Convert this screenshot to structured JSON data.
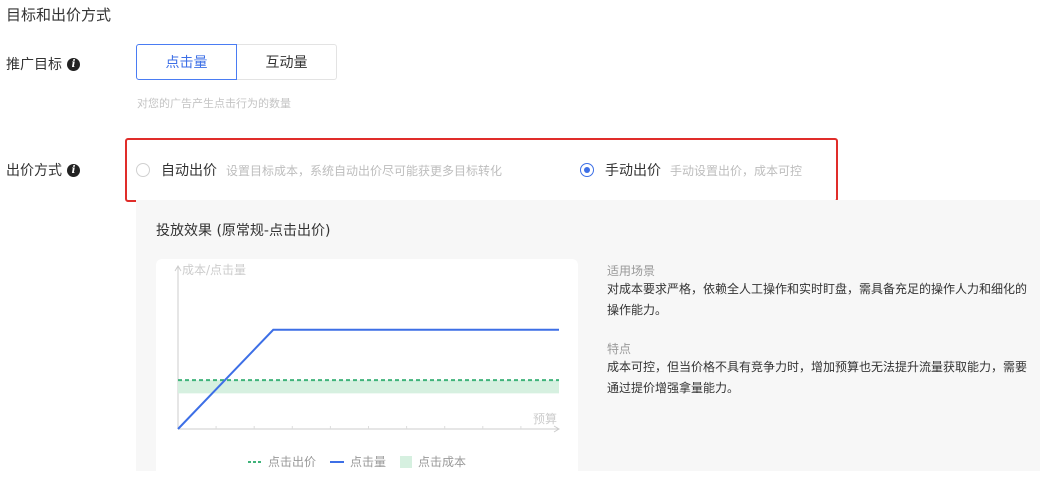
{
  "section": {
    "title": "目标和出价方式"
  },
  "goal": {
    "label": "推广目标",
    "options": [
      "点击量",
      "互动量"
    ],
    "selected": "点击量",
    "hint": "对您的广告产生点击行为的数量"
  },
  "bidding": {
    "label": "出价方式",
    "options": [
      {
        "title": "自动出价",
        "desc": "设置目标成本，系统自动出价尽可能获更多目标转化",
        "checked": false
      },
      {
        "title": "手动出价",
        "desc": "手动设置出价，成本可控",
        "checked": true
      }
    ]
  },
  "effect": {
    "title": "投放效果 (原常规-点击出价)",
    "scenario_label": "适用场景",
    "scenario_text": "对成本要求严格，依赖全人工操作和实时盯盘，需具备充足的操作人力和细化的操作能力。",
    "feature_label": "特点",
    "feature_text": "成本可控，但当价格不具有竞争力时，增加预算也无法提升流量获取能力，需要通过提价增强拿量能力。"
  },
  "colors": {
    "accent": "#3d6fe6",
    "highlight_border": "#e02d2a",
    "bid_line": "#3fb37a",
    "clicks_line": "#3d6fe6",
    "cost_band": "#d6f0e0"
  },
  "chart_data": {
    "type": "line",
    "ylabel": "成本/点击量",
    "xlabel": "预算",
    "ylim": [
      0,
      10
    ],
    "xlim": [
      0,
      10
    ],
    "series": [
      {
        "name": "点击出价",
        "style": "dashed",
        "x": [
          0,
          10
        ],
        "y": [
          3.15,
          3.15
        ]
      },
      {
        "name": "点击量",
        "style": "solid",
        "x": [
          0,
          2.5,
          10
        ],
        "y": [
          0,
          6.4,
          6.4
        ]
      },
      {
        "name": "点击成本",
        "style": "band",
        "x": [
          0,
          10
        ],
        "y_low": [
          2.3,
          2.3
        ],
        "y_high": [
          3.15,
          3.15
        ]
      }
    ],
    "legend": [
      "点击出价",
      "点击量",
      "点击成本"
    ],
    "legend_position": "bottom",
    "grid": false
  }
}
